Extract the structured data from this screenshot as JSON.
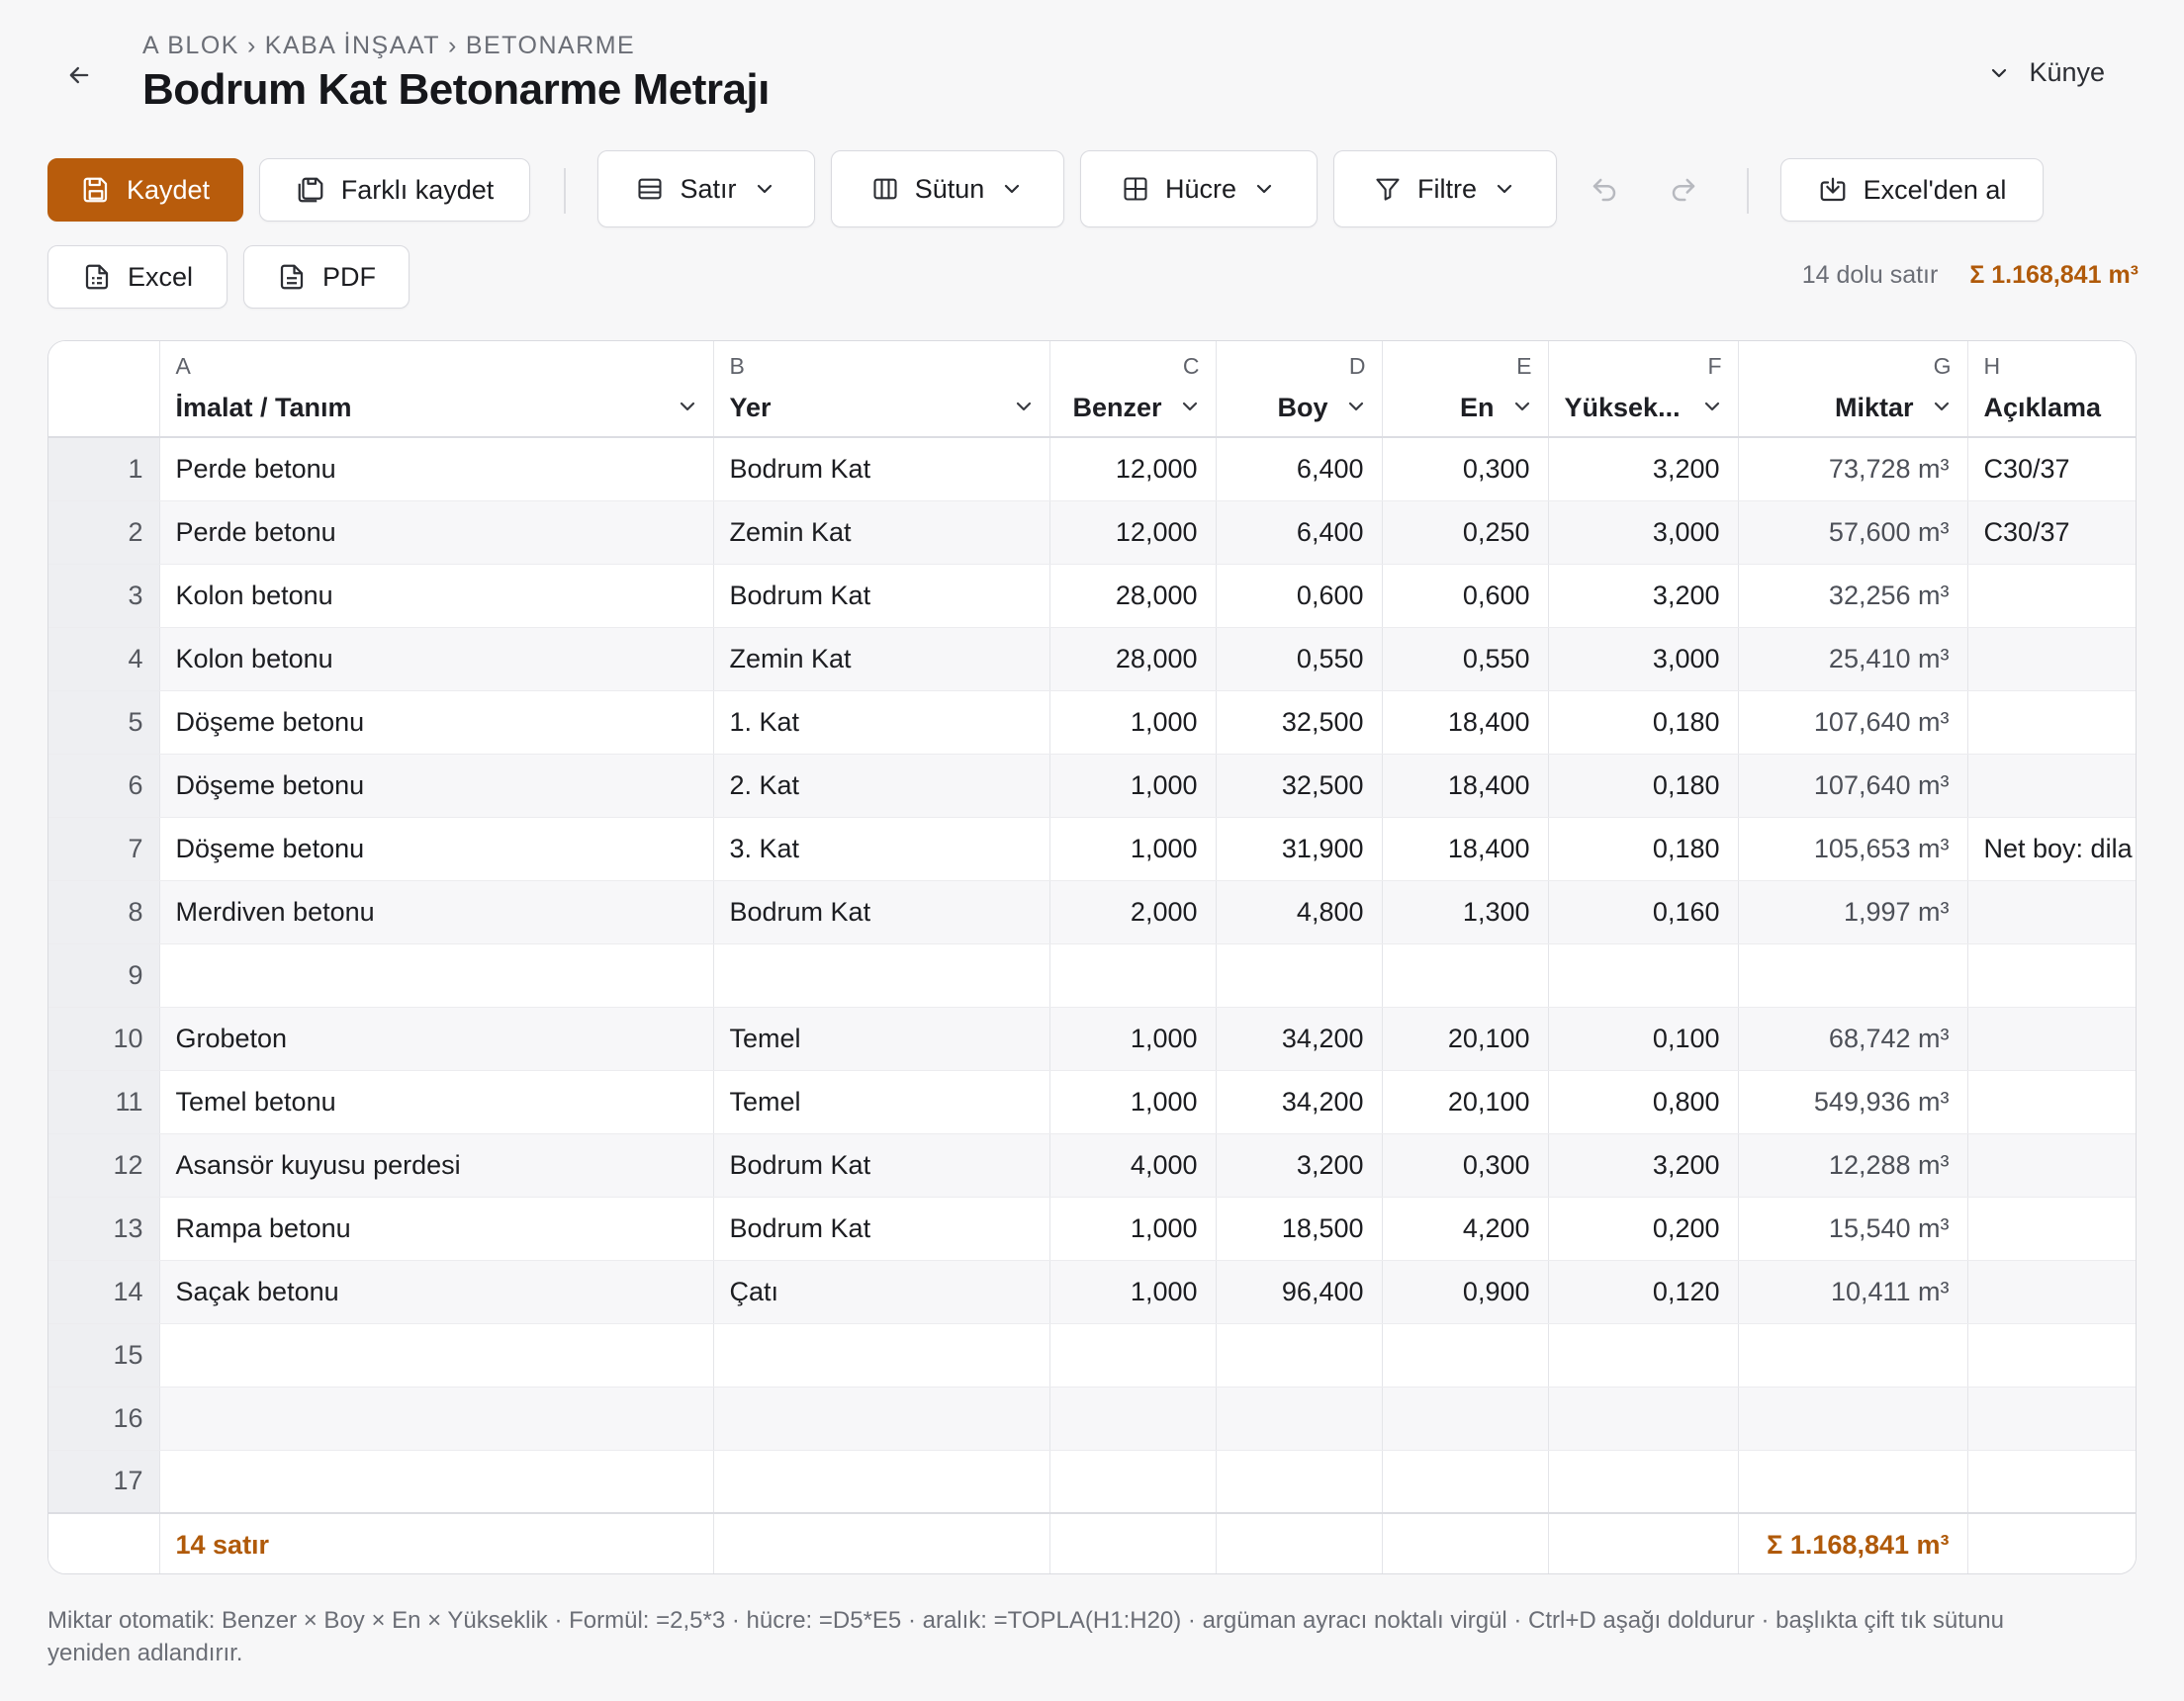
{
  "header": {
    "breadcrumb": [
      "A BLOK",
      "KABA İNŞAAT",
      "BETONARME"
    ],
    "breadcrumb_sep": "›",
    "title": "Bodrum Kat Betonarme Metrajı",
    "kunye_label": "Künye"
  },
  "toolbar": {
    "save_label": "Kaydet",
    "save_as_label": "Farklı kaydet",
    "row_menu_label": "Satır",
    "column_menu_label": "Sütun",
    "cell_menu_label": "Hücre",
    "filter_menu_label": "Filtre",
    "import_excel_label": "Excel'den al",
    "export_excel_label": "Excel",
    "export_pdf_label": "PDF"
  },
  "stats": {
    "filled_rows": "14 dolu satır",
    "total": "Σ 1.168,841 m³"
  },
  "grid": {
    "columns": [
      {
        "letter": "A",
        "title": "İmalat / Tanım"
      },
      {
        "letter": "B",
        "title": "Yer"
      },
      {
        "letter": "C",
        "title": "Benzer"
      },
      {
        "letter": "D",
        "title": "Boy"
      },
      {
        "letter": "E",
        "title": "En"
      },
      {
        "letter": "F",
        "title": "Yüksek..."
      },
      {
        "letter": "G",
        "title": "Miktar"
      },
      {
        "letter": "H",
        "title": "Açıklama"
      }
    ],
    "rows": [
      {
        "n": "1",
        "a": "Perde betonu",
        "b": "Bodrum Kat",
        "c": "12,000",
        "d": "6,400",
        "e": "0,300",
        "f": "3,200",
        "g": "73,728 m³",
        "h": "C30/37"
      },
      {
        "n": "2",
        "a": "Perde betonu",
        "b": "Zemin Kat",
        "c": "12,000",
        "d": "6,400",
        "e": "0,250",
        "f": "3,000",
        "g": "57,600 m³",
        "h": "C30/37"
      },
      {
        "n": "3",
        "a": "Kolon betonu",
        "b": "Bodrum Kat",
        "c": "28,000",
        "d": "0,600",
        "e": "0,600",
        "f": "3,200",
        "g": "32,256 m³",
        "h": ""
      },
      {
        "n": "4",
        "a": "Kolon betonu",
        "b": "Zemin Kat",
        "c": "28,000",
        "d": "0,550",
        "e": "0,550",
        "f": "3,000",
        "g": "25,410 m³",
        "h": ""
      },
      {
        "n": "5",
        "a": "Döşeme betonu",
        "b": "1. Kat",
        "c": "1,000",
        "d": "32,500",
        "e": "18,400",
        "f": "0,180",
        "g": "107,640 m³",
        "h": ""
      },
      {
        "n": "6",
        "a": "Döşeme betonu",
        "b": "2. Kat",
        "c": "1,000",
        "d": "32,500",
        "e": "18,400",
        "f": "0,180",
        "g": "107,640 m³",
        "h": ""
      },
      {
        "n": "7",
        "a": "Döşeme betonu",
        "b": "3. Kat",
        "c": "1,000",
        "d": "31,900",
        "e": "18,400",
        "f": "0,180",
        "g": "105,653 m³",
        "h": "Net boy: dila"
      },
      {
        "n": "8",
        "a": "Merdiven betonu",
        "b": "Bodrum Kat",
        "c": "2,000",
        "d": "4,800",
        "e": "1,300",
        "f": "0,160",
        "g": "1,997 m³",
        "h": ""
      },
      {
        "n": "9",
        "a": "",
        "b": "",
        "c": "",
        "d": "",
        "e": "",
        "f": "",
        "g": "",
        "h": ""
      },
      {
        "n": "10",
        "a": "Grobeton",
        "b": "Temel",
        "c": "1,000",
        "d": "34,200",
        "e": "20,100",
        "f": "0,100",
        "g": "68,742 m³",
        "h": ""
      },
      {
        "n": "11",
        "a": "Temel betonu",
        "b": "Temel",
        "c": "1,000",
        "d": "34,200",
        "e": "20,100",
        "f": "0,800",
        "g": "549,936 m³",
        "h": ""
      },
      {
        "n": "12",
        "a": "Asansör kuyusu perdesi",
        "b": "Bodrum Kat",
        "c": "4,000",
        "d": "3,200",
        "e": "0,300",
        "f": "3,200",
        "g": "12,288 m³",
        "h": ""
      },
      {
        "n": "13",
        "a": "Rampa betonu",
        "b": "Bodrum Kat",
        "c": "1,000",
        "d": "18,500",
        "e": "4,200",
        "f": "0,200",
        "g": "15,540 m³",
        "h": ""
      },
      {
        "n": "14",
        "a": "Saçak betonu",
        "b": "Çatı",
        "c": "1,000",
        "d": "96,400",
        "e": "0,900",
        "f": "0,120",
        "g": "10,411 m³",
        "h": ""
      },
      {
        "n": "15",
        "a": "",
        "b": "",
        "c": "",
        "d": "",
        "e": "",
        "f": "",
        "g": "",
        "h": ""
      },
      {
        "n": "16",
        "a": "",
        "b": "",
        "c": "",
        "d": "",
        "e": "",
        "f": "",
        "g": "",
        "h": ""
      },
      {
        "n": "17",
        "a": "",
        "b": "",
        "c": "",
        "d": "",
        "e": "",
        "f": "",
        "g": "",
        "h": ""
      }
    ],
    "footer": {
      "row_count": "14 satır",
      "total": "Σ 1.168,841 m³"
    }
  },
  "hint": "Miktar otomatik: Benzer × Boy × En × Yükseklik · Formül: =2,5*3 · hücre: =D5*E5 · aralık: =TOPLA(H1:H20) · argüman ayracı noktalı virgül · Ctrl+D aşağı doldurur · başlıkta çift tık sütunu yeniden adlandırır.",
  "colors": {
    "accent": "#b85c0c",
    "accent_text": "#b05a0a"
  },
  "icons": {
    "back": "arrow-left-icon",
    "kunye": "chevron-down-icon",
    "save": "save-icon",
    "save_as": "save-as-icon",
    "row": "rows-icon",
    "column": "columns-icon",
    "cell": "grid-icon",
    "filter": "funnel-icon",
    "undo": "undo-icon",
    "redo": "redo-icon",
    "import": "download-tray-icon",
    "excel": "spreadsheet-file-icon",
    "pdf": "document-file-icon"
  }
}
